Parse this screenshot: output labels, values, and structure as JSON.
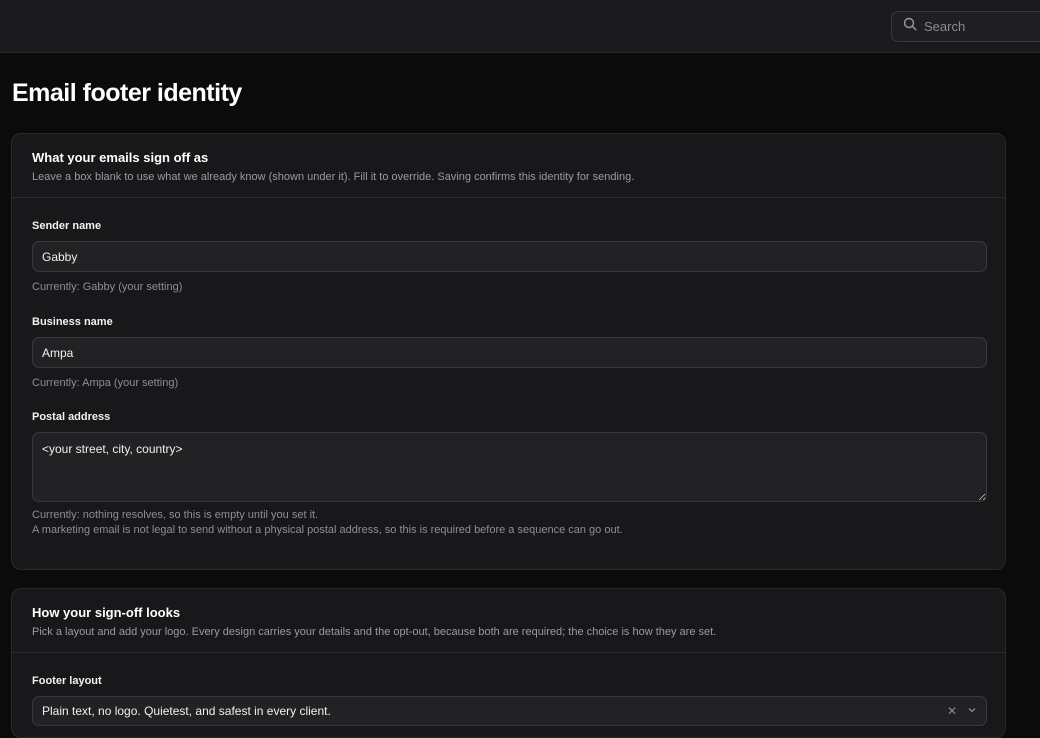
{
  "header": {
    "search": {
      "placeholder": "Search",
      "value": "",
      "icon": "search-icon"
    }
  },
  "page": {
    "title": "Email footer identity"
  },
  "identity_card": {
    "title": "What your emails sign off as",
    "description": "Leave a box blank to use what we already know (shown under it). Fill it to override. Saving confirms this identity for sending.",
    "fields": {
      "sender_name": {
        "label": "Sender name",
        "value": "Gabby",
        "help": "Currently: Gabby (your setting)"
      },
      "business_name": {
        "label": "Business name",
        "value": "Ampa",
        "help": "Currently: Ampa (your setting)"
      },
      "postal_address": {
        "label": "Postal address",
        "value": "<your street, city, country>",
        "help": "Currently: nothing resolves, so this is empty until you set it.",
        "help_extra": "A marketing email is not legal to send without a physical postal address, so this is required before a sequence can go out."
      }
    }
  },
  "signoff_card": {
    "title": "How your sign-off looks",
    "description": "Pick a layout and add your logo. Every design carries your details and the opt-out, because both are required; the choice is how they are set.",
    "footer_layout": {
      "label": "Footer layout",
      "selected": "Plain text, no logo. Quietest, and safest in every client.",
      "clear_icon": "close-icon",
      "dropdown_icon": "chevron-down-icon"
    }
  },
  "colors": {
    "background": "#0b0b0c",
    "card": "#18181a",
    "input": "#222225",
    "border": "#3a3a3e"
  }
}
